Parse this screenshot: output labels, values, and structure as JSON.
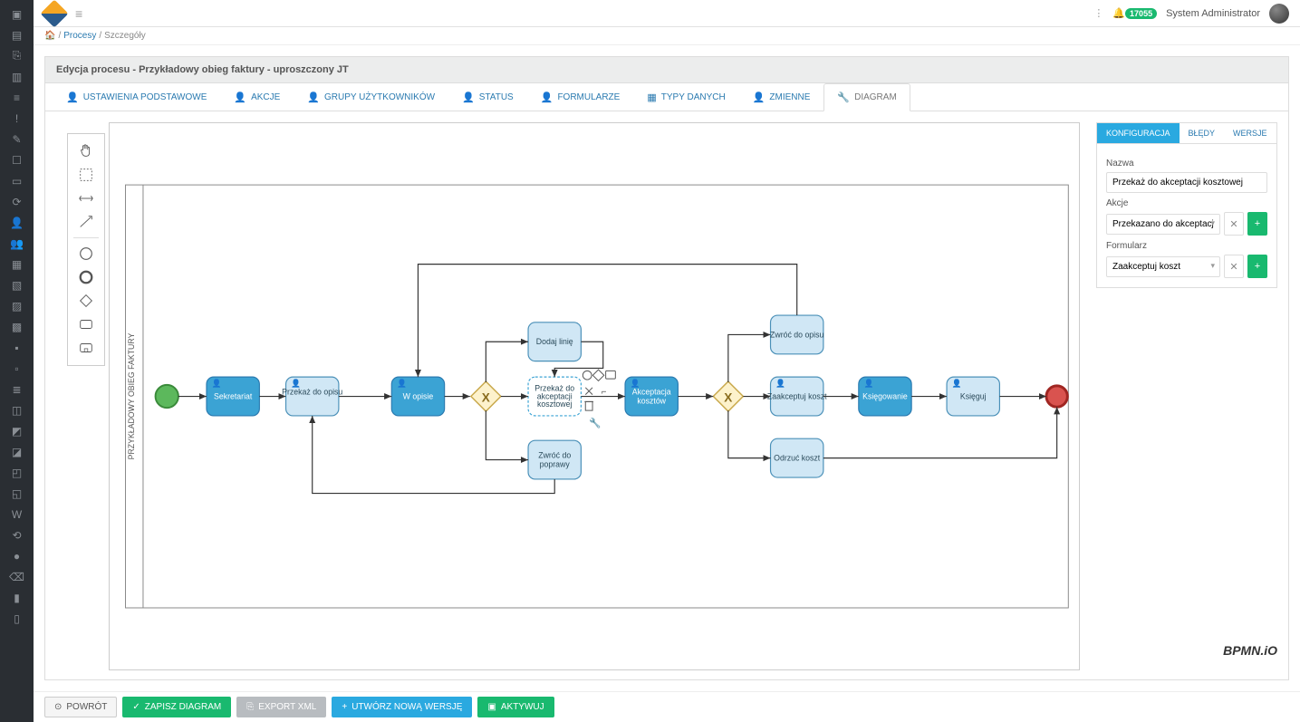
{
  "topbar": {
    "badge": "17055",
    "user": "System Administrator"
  },
  "breadcrumb": {
    "home": "⌂",
    "procesy": "Procesy",
    "szczegoly": "Szczegóły"
  },
  "title": "Edycja procesu - Przykładowy obieg faktury - uproszczony JT",
  "tabs": {
    "ustawienia": "USTAWIENIA PODSTAWOWE",
    "akcje": "AKCJE",
    "grupy": "GRUPY UŻYTKOWNIKÓW",
    "status": "STATUS",
    "formularze": "FORMULARZE",
    "typy": "TYPY DANYCH",
    "zmienne": "ZMIENNE",
    "diagram": "DIAGRAM"
  },
  "sidepanel": {
    "tabs": {
      "konfiguracja": "KONFIGURACJA",
      "bledy": "BŁĘDY",
      "wersje": "WERSJE"
    },
    "nazwa_label": "Nazwa",
    "nazwa_value": "Przekaż do akceptacji kosztowej",
    "akcje_label": "Akcje",
    "akcje_value": "Przekazano do akceptacji",
    "formularz_label": "Formularz",
    "formularz_value": "Zaakceptuj koszt"
  },
  "footer": {
    "powrot": "POWRÓT",
    "zapisz": "ZAPISZ DIAGRAM",
    "export": "EXPORT XML",
    "utworz": "UTWÓRZ NOWĄ WERSJĘ",
    "aktywuj": "AKTYWUJ"
  },
  "diagram": {
    "lane_label": "PRZYKŁADOWY OBIEG FAKTURY",
    "tasks": {
      "sekretariat": "Sekretariat",
      "przekaz_opis": "Przekaż do opisu",
      "wopisie": "W opisie",
      "dodaj_linie": "Dodaj linię",
      "przekaz_akc": "Przekaż do akceptacji kosztowej",
      "zwroc_poprawy": "Zwróć do poprawy",
      "akceptacja": "Akceptacja kosztów",
      "zwroc_opisu": "Zwróć do opisu",
      "zaakceptuj": "Zaakceptuj koszt",
      "odrzuc": "Odrzuć koszt",
      "ksiegowanie": "Księgowanie",
      "ksieguj": "Księguj"
    }
  },
  "bpmn_logo": "BPMN.iO"
}
